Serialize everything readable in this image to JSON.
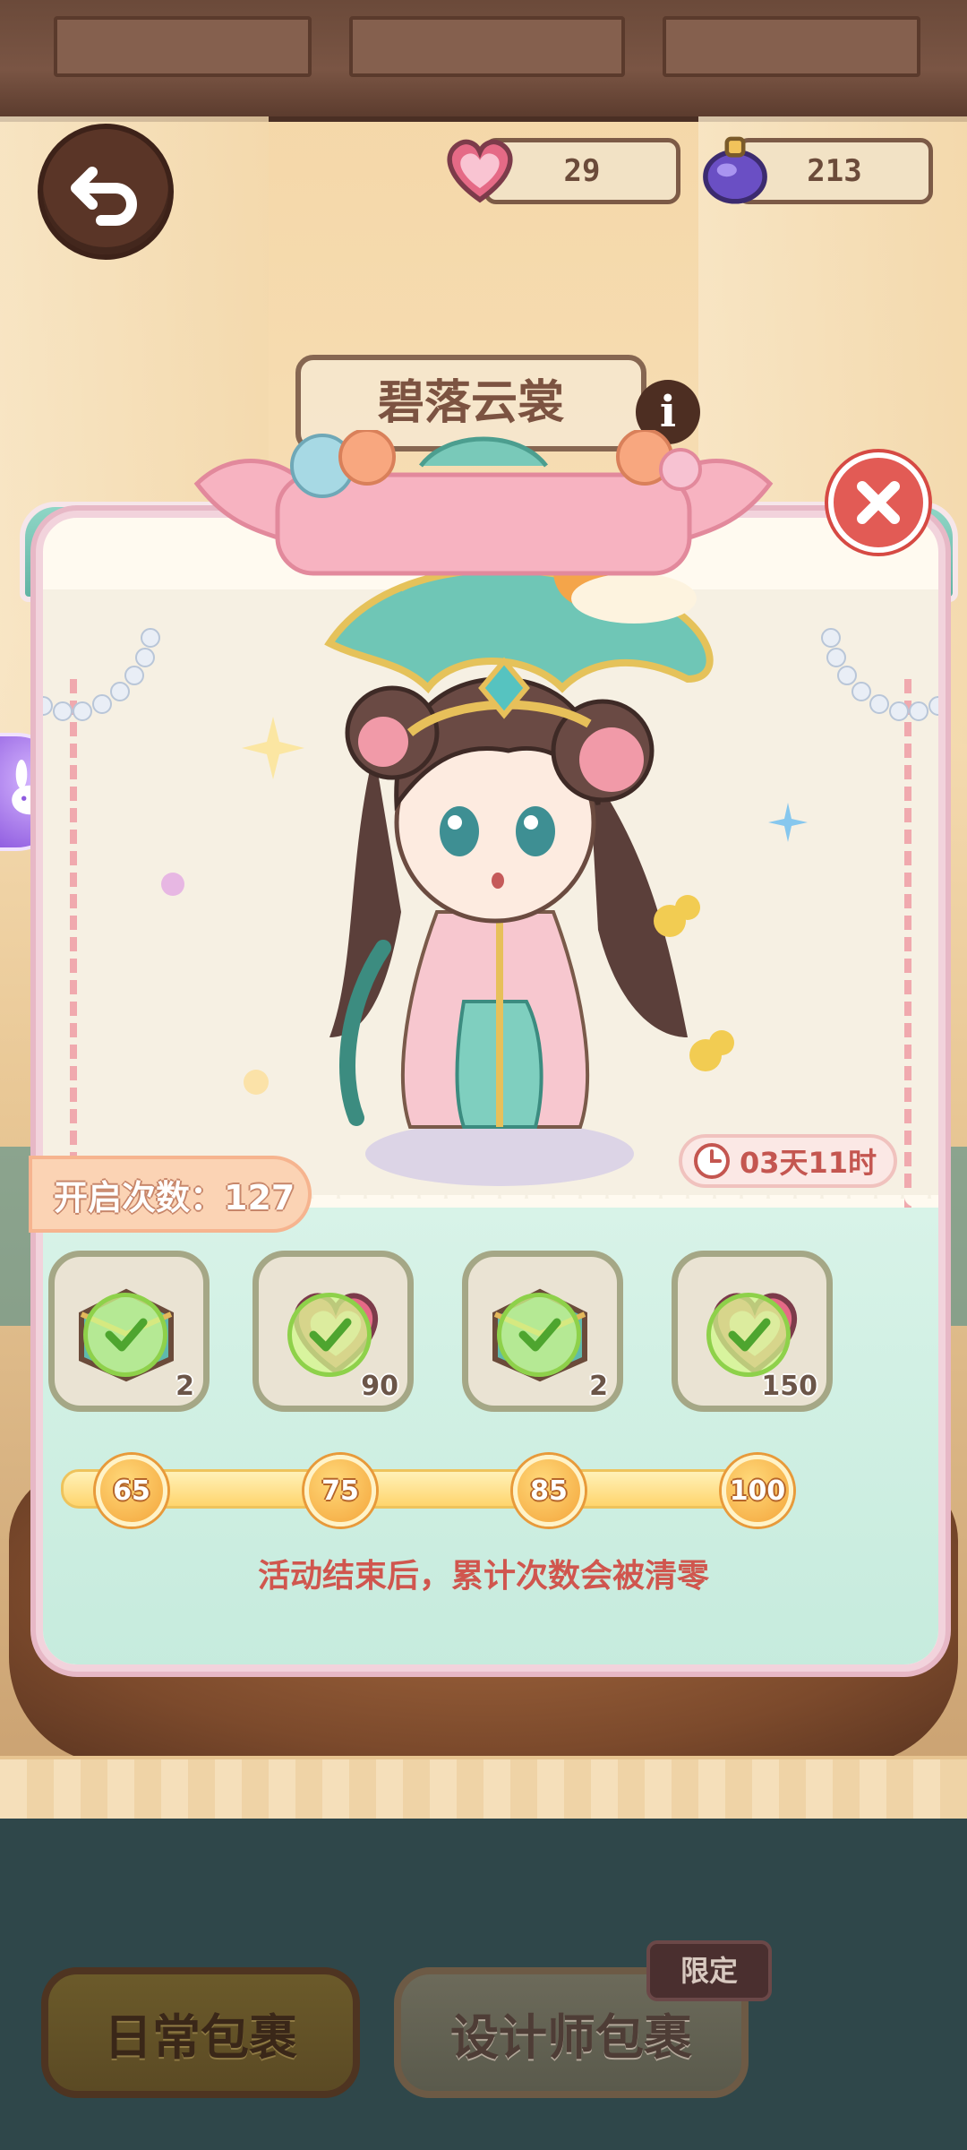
{
  "hud": {
    "hearts_count": "29",
    "gems_count": "213"
  },
  "background": {
    "event_title": "碧落云裳"
  },
  "panel": {
    "timer": "03天11时",
    "open_count_label": "开启次数：127",
    "rewards": [
      {
        "icon": "treasure-chest-icon",
        "qty": "2"
      },
      {
        "icon": "heart-icon",
        "qty": "90"
      },
      {
        "icon": "treasure-chest-icon",
        "qty": "2"
      },
      {
        "icon": "heart-icon",
        "qty": "150"
      }
    ],
    "milestones": [
      "65",
      "75",
      "85",
      "100"
    ],
    "progress": 1.0,
    "notice": "活动结束后，累计次数会被清零"
  },
  "bottom": {
    "daily_package": "日常包裹",
    "designer_package": "设计师包裹",
    "limited_tag": "限定"
  },
  "colors": {
    "accent_teal": "#62b3a3",
    "accent_red": "#e25b55",
    "text_red": "#d0564e"
  }
}
